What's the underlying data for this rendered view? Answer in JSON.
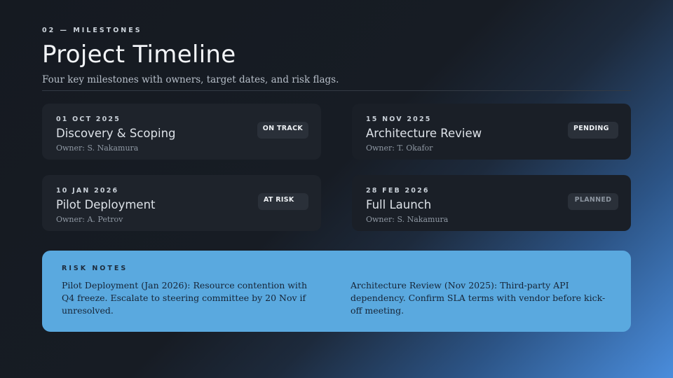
{
  "header": {
    "eyebrow": "02 — MILESTONES",
    "title": "Project Timeline",
    "subtitle": "Four key milestones with owners, target dates, and risk flags."
  },
  "milestones": [
    {
      "date": "01 OCT 2025",
      "name": "Discovery & Scoping",
      "owner": "Owner: S. Nakamura",
      "status": "ON TRACK"
    },
    {
      "date": "15 NOV 2025",
      "name": "Architecture Review",
      "owner": "Owner: T. Okafor",
      "status": "PENDING"
    },
    {
      "date": "10 JAN 2026",
      "name": "Pilot Deployment",
      "owner": "Owner: A. Petrov",
      "status": "AT RISK"
    },
    {
      "date": "28 FEB 2026",
      "name": "Full Launch",
      "owner": "Owner: S. Nakamura",
      "status": "PLANNED"
    }
  ],
  "risk_notes": {
    "label": "RISK NOTES",
    "notes": [
      "Pilot Deployment (Jan 2026): Resource contention with Q4 freeze. Escalate to steering committee by 20 Nov if unresolved.",
      "Architecture Review (Nov 2025): Third-party API dependency. Confirm SLA terms with vendor before kick-off meeting."
    ]
  },
  "colors": {
    "risk_panel": "#5aa9df",
    "card_background": "#1e232b",
    "gradient_accent": "#4a8ddc"
  }
}
